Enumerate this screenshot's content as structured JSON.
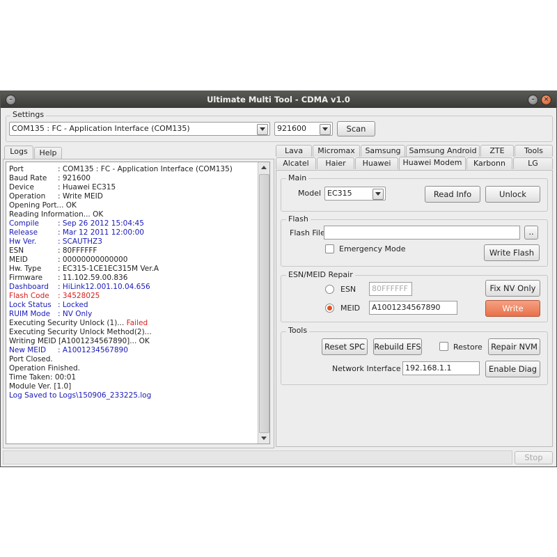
{
  "window": {
    "title": "Ultimate Multi Tool - CDMA v1.0"
  },
  "settings": {
    "label": "Settings",
    "port_value": "COM135 : FC - Application Interface (COM135)",
    "baud_value": "921600",
    "scan_label": "Scan"
  },
  "left_tabs": [
    {
      "label": "Logs"
    },
    {
      "label": "Help"
    }
  ],
  "log_lines": [
    {
      "key": "Port",
      "value": ": COM135 : FC - Application Interface (COM135)",
      "color": "#222222"
    },
    {
      "key": "Baud Rate",
      "value": ": 921600",
      "color": "#222222"
    },
    {
      "key": "Device",
      "value": ": Huawei EC315",
      "color": "#222222"
    },
    {
      "key": "Operation",
      "value": ": Write MEID",
      "color": "#222222"
    },
    {
      "key": "",
      "value": "Opening Port... OK",
      "color": "#222222"
    },
    {
      "key": "",
      "value": "Reading Information... OK",
      "color": "#222222"
    },
    {
      "key": "Compile",
      "value": ": Sep 26 2012 15:04:45",
      "color": "#1a1ab8"
    },
    {
      "key": "Release",
      "value": ": Mar 12 2011 12:00:00",
      "color": "#1a1ab8"
    },
    {
      "key": "Hw Ver.",
      "value": ": SCAUTHZ3",
      "color": "#1a1ab8"
    },
    {
      "key": "ESN",
      "value": ": 80FFFFFF",
      "color": "#222222"
    },
    {
      "key": "MEID",
      "value": ": 00000000000000",
      "color": "#222222"
    },
    {
      "key": "Hw. Type",
      "value": ": EC315-1CE1EC315M Ver.A",
      "color": "#222222"
    },
    {
      "key": "Firmware",
      "value": ": 11.102.59.00.836",
      "color": "#222222"
    },
    {
      "key": "Dashboard",
      "value": ": HiLink12.001.10.04.656",
      "color": "#1a1ab8"
    },
    {
      "key": "Flash Code",
      "value": ": 34528025",
      "color": "#d42020"
    },
    {
      "key": "Lock Status",
      "value": ": Locked",
      "color": "#1a1ab8"
    },
    {
      "key": "RUIM Mode",
      "value": ": NV Only",
      "color": "#1a1ab8"
    },
    {
      "key": "",
      "value": "Executing Security Unlock (1)... ",
      "suffix": "Failed",
      "suffix_color": "#d42020",
      "color": "#222222"
    },
    {
      "key": "",
      "value": "Executing Security Unlock Method(2)...",
      "color": "#222222"
    },
    {
      "key": "",
      "value": "Writing MEID [A1001234567890]... OK",
      "color": "#222222"
    },
    {
      "key": "New MEID",
      "value": ": A1001234567890",
      "color": "#1a1ab8"
    },
    {
      "key": "",
      "value": "Port Closed.",
      "color": "#222222"
    },
    {
      "key": "",
      "value": "Operation Finished.",
      "color": "#222222"
    },
    {
      "key": "",
      "value": "Time Taken: 00:01",
      "color": "#222222"
    },
    {
      "key": "",
      "value": "Module Ver. [1.0]",
      "color": "#222222"
    },
    {
      "key": "",
      "value": "Log Saved to Logs\\150906_233225.log",
      "color": "#1a1ab8"
    }
  ],
  "vendor_tabs_row1": [
    {
      "label": "Lava"
    },
    {
      "label": "Micromax"
    },
    {
      "label": "Samsung"
    },
    {
      "label": "Samsung Android"
    },
    {
      "label": "ZTE"
    },
    {
      "label": "Tools"
    }
  ],
  "vendor_tabs_row2": [
    {
      "label": "Alcatel"
    },
    {
      "label": "Haier"
    },
    {
      "label": "Huawei"
    },
    {
      "label": "Huawei Modem"
    },
    {
      "label": "Karbonn"
    },
    {
      "label": "LG"
    }
  ],
  "main": {
    "label": "Main",
    "model_label": "Model",
    "model_value": "EC315",
    "read_info_label": "Read Info",
    "unlock_label": "Unlock"
  },
  "flash": {
    "label": "Flash",
    "file_label": "Flash File",
    "file_value": "",
    "browse_label": "..",
    "emergency_label": "Emergency Mode",
    "write_flash_label": "Write Flash"
  },
  "repair": {
    "label": "ESN/MEID Repair",
    "esn_label": "ESN",
    "esn_value": "80FFFFFF",
    "meid_label": "MEID",
    "meid_value": "A1001234567890",
    "fix_nv_label": "Fix NV Only",
    "write_label": "Write"
  },
  "tools": {
    "label": "Tools",
    "reset_spc_label": "Reset SPC",
    "rebuild_efs_label": "Rebuild EFS",
    "restore_label": "Restore",
    "repair_nvm_label": "Repair NVM",
    "net_ip_label": "Network Interface IP",
    "net_ip_value": "192.168.1.1",
    "enable_diag_label": "Enable Diag"
  },
  "status": {
    "stop_label": "Stop"
  },
  "colors": {
    "accent_orange": "#e8714b",
    "log_blue": "#1a1ab8",
    "log_red": "#d42020"
  }
}
